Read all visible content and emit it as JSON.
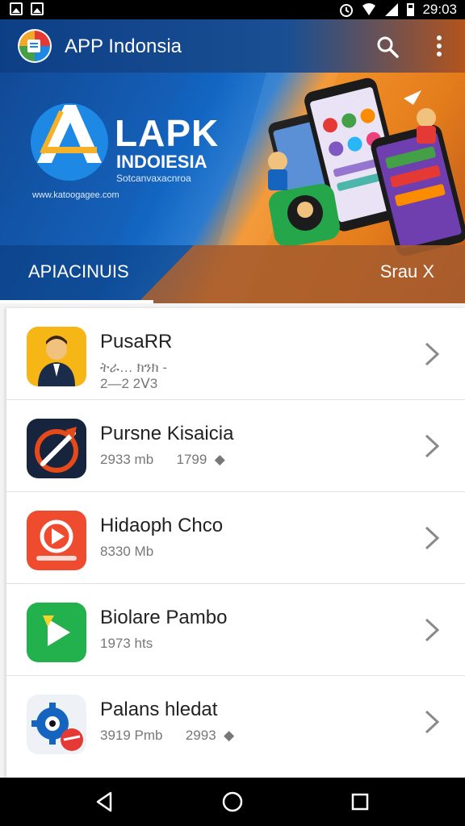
{
  "status_bar": {
    "time": "29:03"
  },
  "app_bar": {
    "title": "APP Indonsia"
  },
  "hero": {
    "brand": "LAPK",
    "brand_sub": "INDOIESIA",
    "tagline": "Sotcanvaxacnroa",
    "url": "www.katoogagee.com"
  },
  "tabs": {
    "left": "APIACINUIS",
    "right": "Srau X"
  },
  "apps": [
    {
      "name": "PusaRR",
      "meta": "ትራ… ክንክ ‑\n2—2 2Ⅴ3"
    },
    {
      "name": "Pursne Kisaicia",
      "meta": "2933 mb      1799  ◆"
    },
    {
      "name": "Hidaoph Chco",
      "meta": "8330 Mb"
    },
    {
      "name": "Biolare Pambo",
      "meta": "1973 hts"
    },
    {
      "name": "Palans hledat",
      "meta": "3919 Pmb      2993  ◆"
    }
  ],
  "colors": {
    "appbar_blue": "#0d3f86",
    "hero_orange": "#f2922a",
    "divider": "#e2e2e2"
  }
}
